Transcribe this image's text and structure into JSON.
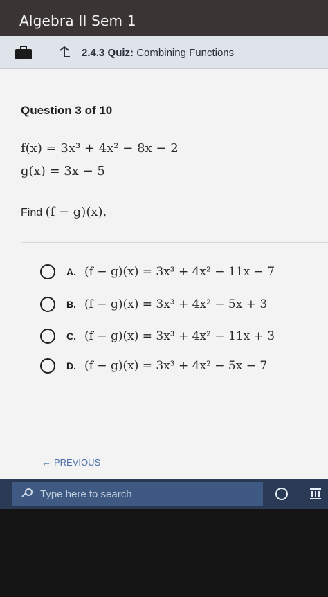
{
  "window": {
    "title": "Algebra II Sem 1"
  },
  "quiz_bar": {
    "icons": [
      "briefcase-icon",
      "up-arrow-icon"
    ],
    "number": "2.4.3",
    "type": "Quiz:",
    "name": "Combining Functions"
  },
  "question": {
    "heading": "Question 3 of 10",
    "f_def": "f(x) = 3x³ + 4x² − 8x − 2",
    "g_def": "g(x) = 3x − 5",
    "find_label": "Find",
    "find_expr": "(f − g)(x)."
  },
  "options": [
    {
      "letter": "A.",
      "expr": "(f − g)(x) = 3x³ + 4x² − 11x − 7"
    },
    {
      "letter": "B.",
      "expr": "(f − g)(x) = 3x³ + 4x² − 5x + 3"
    },
    {
      "letter": "C.",
      "expr": "(f − g)(x) = 3x³ + 4x² − 11x + 3"
    },
    {
      "letter": "D.",
      "expr": "(f − g)(x) = 3x³ + 4x² − 5x − 7"
    }
  ],
  "navigation": {
    "previous_label": "PREVIOUS"
  },
  "taskbar": {
    "search_placeholder": "Type here to search",
    "icons": [
      "search-icon",
      "cortana-icon",
      "task-view-icon"
    ]
  },
  "colors": {
    "title_bar": "#3a3434",
    "quiz_bar": "#dfe3ea",
    "content_bg": "#f3f3f3",
    "taskbar": "#2a3a55",
    "search_box": "#3e5a82",
    "link": "#4a6fa8"
  }
}
